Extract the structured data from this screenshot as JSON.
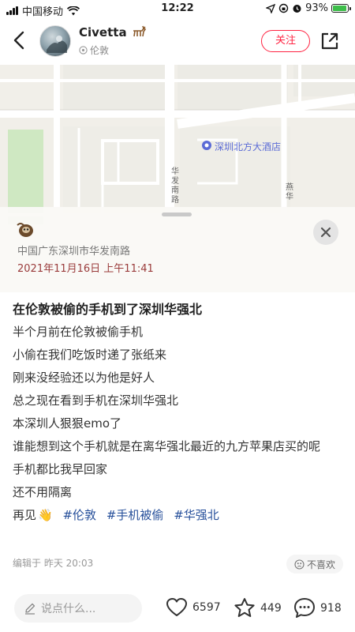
{
  "status_bar": {
    "carrier": "中国移动",
    "time": "12:22",
    "battery": "93%",
    "battery_level": 0.93
  },
  "header": {
    "author_name": "Civetta",
    "author_location": "伦敦",
    "follow_label": "关注",
    "icons": [
      "back-icon",
      "share-icon",
      "location-pin-icon"
    ]
  },
  "map": {
    "poi_label": "深圳北方大酒店",
    "road_label": "华发南路",
    "road_label_2": "燕华"
  },
  "location_card": {
    "address": "中国广东深圳市华发南路",
    "datetime": "2021年11月16日 上午11:41"
  },
  "note": {
    "title": "在伦敦被偷的手机到了深圳华强北",
    "lines": [
      "半个月前在伦敦被偷手机",
      "小偷在我们吃饭时递了张纸来",
      "刚来没经验还以为他是好人",
      "总之现在看到手机在深圳华强北",
      "本深圳人狠狠emo了",
      "谁能想到这个手机就是在离华强北最近的九方苹果店买的呢",
      "手机都比我早回家",
      "还不用隔离"
    ],
    "last_line_text": "再见",
    "last_line_emoji": "👋",
    "tags": [
      "#伦敦",
      "#手机被偷",
      "#华强北"
    ]
  },
  "meta": {
    "edited": "编辑于 昨天 20:03",
    "dislike_label": "不喜欢"
  },
  "bottom_bar": {
    "comment_placeholder": "说点什么...",
    "likes": "6597",
    "collects": "449",
    "comments": "918"
  },
  "colors": {
    "accent": "#ff2442",
    "tag": "#264f9a",
    "poi": "#5b6bd6",
    "map_bg": "#f1efe9"
  }
}
